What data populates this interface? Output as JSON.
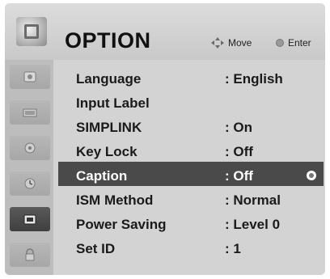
{
  "header": {
    "title": "OPTION",
    "move_label": "Move",
    "enter_label": "Enter"
  },
  "sidebar": {
    "items": [
      {
        "icon": "picture-icon"
      },
      {
        "icon": "input-icon"
      },
      {
        "icon": "disc-icon"
      },
      {
        "icon": "clock-icon"
      },
      {
        "icon": "option-icon",
        "active": true
      },
      {
        "icon": "lock-icon"
      }
    ]
  },
  "menu": {
    "items": [
      {
        "label": "Language",
        "value": ": English"
      },
      {
        "label": "Input Label",
        "value": ""
      },
      {
        "label": "SIMPLINK",
        "value": ": On"
      },
      {
        "label": "Key Lock",
        "value": ": Off"
      },
      {
        "label": "Caption",
        "value": ": Off",
        "selected": true
      },
      {
        "label": "ISM Method",
        "value": ": Normal"
      },
      {
        "label": "Power Saving",
        "value": ": Level 0"
      },
      {
        "label": "Set ID",
        "value": ": 1"
      }
    ]
  },
  "colors": {
    "background": "#d3d3d3",
    "selected_row": "#4a4a4a",
    "text": "#1a1a1a"
  }
}
